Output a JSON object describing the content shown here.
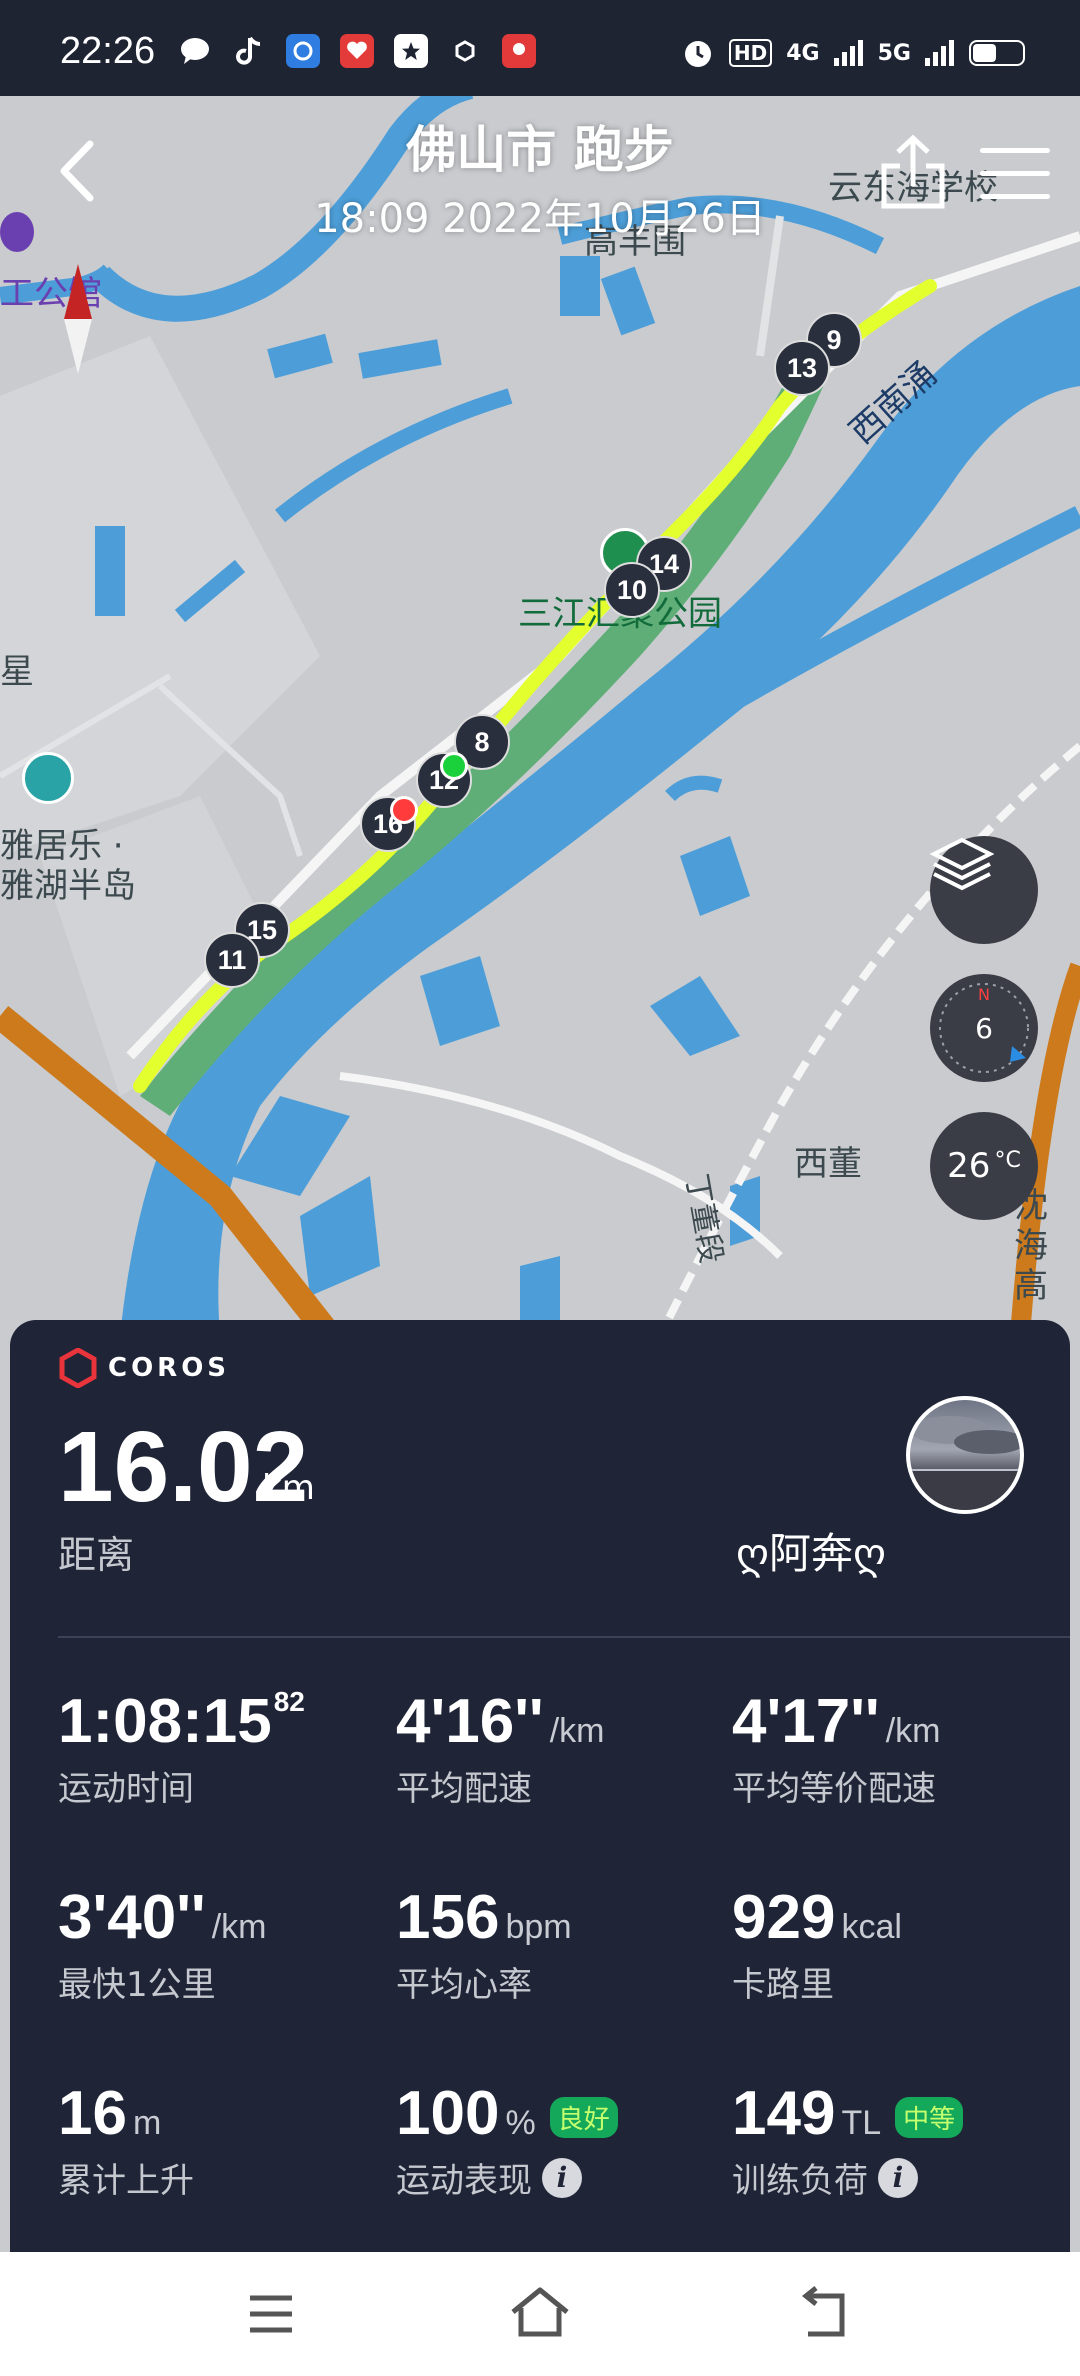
{
  "status_bar": {
    "time": "22:26",
    "network_hd": "HD",
    "network_4g": "4G",
    "network_5g": "5G",
    "battery_level": 0.45
  },
  "header": {
    "title": "佛山市 跑步",
    "subtitle": "18:09 2022年10月26日"
  },
  "map": {
    "labels": {
      "school": "云东海学校",
      "area1": "高丰围",
      "park_cut": "工公馆",
      "river": "西南涌",
      "park": "三江汇聚公园",
      "left_edge": "星",
      "estate1": "雅居乐 ·",
      "estate2": "雅湖半岛",
      "village": "西董",
      "road1": "丁董段",
      "road2": "沈海高"
    },
    "markers": [
      "9",
      "13",
      "14",
      "10",
      "8",
      "12",
      "16",
      "15",
      "11"
    ],
    "compass_value": "6",
    "temperature": "26",
    "temperature_unit": "°C"
  },
  "summary": {
    "brand": "COROS",
    "distance": "16.02",
    "distance_unit": "km",
    "distance_label": "距离",
    "username": "ღ阿奔ღ",
    "stats": [
      {
        "value": "1:08:15",
        "sup": "82",
        "unit": "",
        "label": "运动时间"
      },
      {
        "value": "4'16''",
        "unit": "/km",
        "label": "平均配速"
      },
      {
        "value": "4'17''",
        "unit": "/km",
        "label": "平均等价配速"
      },
      {
        "value": "3'40''",
        "unit": "/km",
        "label": "最快1公里"
      },
      {
        "value": "156",
        "unit": "bpm",
        "label": "平均心率"
      },
      {
        "value": "929",
        "unit": "kcal",
        "label": "卡路里"
      },
      {
        "value": "16",
        "unit": "m",
        "label": "累计上升"
      },
      {
        "value": "100",
        "unit": "%",
        "badge": "良好",
        "label": "运动表现"
      },
      {
        "value": "149",
        "unit": "TL",
        "badge": "中等",
        "label": "训练负荷"
      }
    ]
  }
}
